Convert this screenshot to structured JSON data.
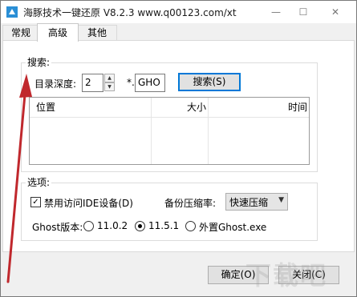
{
  "window": {
    "title": "海豚技术一键还原 V8.2.3 www.q00123.com/xt",
    "minimize_glyph": "—",
    "maximize_glyph": "☐",
    "close_glyph": "✕"
  },
  "tabs": [
    {
      "label": "常规",
      "active": false
    },
    {
      "label": "高级",
      "active": true
    },
    {
      "label": "其他",
      "active": false
    }
  ],
  "search": {
    "group_label": "搜索:",
    "depth_label": "目录深度:",
    "depth_value": "2",
    "ext_prefix": "*.",
    "ext_value": "GHO",
    "search_button": "搜索(S)"
  },
  "results_list": {
    "columns": [
      "位置",
      "大小",
      "时间"
    ],
    "rows": []
  },
  "options": {
    "group_label": "选项:",
    "disable_ide_label": "禁用访问IDE设备(D)",
    "disable_ide_checked": true,
    "compression_label": "备份压缩率:",
    "compression_value": "快速压缩",
    "ghost_version_label": "Ghost版本:",
    "ghost_versions": [
      {
        "label": "11.0.2",
        "selected": false
      },
      {
        "label": "11.5.1",
        "selected": true
      },
      {
        "label": "外置Ghost.exe",
        "selected": false
      }
    ]
  },
  "footer": {
    "ok_button": "确定(O)",
    "close_button": "关闭(C)"
  },
  "icons": {
    "app": "app-logo-icon",
    "spin_up": "▲",
    "spin_down": "▼",
    "combo_arrow": "▼",
    "check_mark": "✓"
  },
  "colors": {
    "annotation_arrow": "#c0282d",
    "focus_border": "#0078d7"
  },
  "watermark": "下载吧"
}
